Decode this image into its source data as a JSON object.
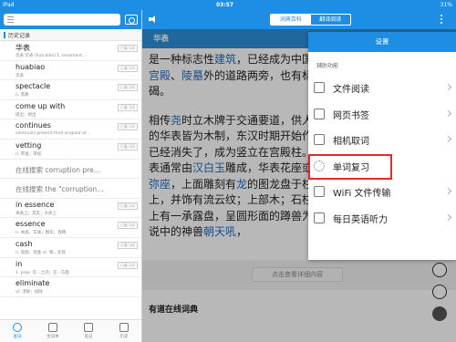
{
  "status_bar": {
    "carrier": "iPad",
    "time": "03:57",
    "battery": "31%"
  },
  "left_pane": {
    "history_header": "历史记录",
    "history": [
      {
        "word": "华表",
        "desc": "华表 华表 [huá biǎo] 1. ornament…",
        "tag": "已复习词"
      },
      {
        "word": "huabiao",
        "desc": "华表",
        "tag": "已复习词"
      },
      {
        "word": "spectacle",
        "desc": "n. 景象",
        "tag": "已复习词"
      },
      {
        "word": "come up with",
        "desc": "提出；想出",
        "tag": "已复习词"
      },
      {
        "word": "continues",
        "desc": "continues present third singular of…",
        "tag": "已复习词"
      },
      {
        "word": "vetting",
        "desc": "n. 审查；审核",
        "tag": "已复习词"
      },
      {
        "word": "在线搜索 corruption pre…",
        "desc": "",
        "tag": ""
      },
      {
        "word": "在线搜索 the \"corruption…",
        "desc": "",
        "tag": ""
      },
      {
        "word": "in essence",
        "desc": "本质上；其实；大体上",
        "tag": "已复习词"
      },
      {
        "word": "essence",
        "desc": "n. 本质，实质；精华；香精",
        "tag": "已复习词"
      },
      {
        "word": "cash",
        "desc": "n. 现款，现金 vt. 将...兑现",
        "tag": "已复习词"
      },
      {
        "word": "in",
        "desc": "1. prep. 在...之内；在...方面",
        "tag": "已复习词"
      },
      {
        "word": "eliminate",
        "desc": "vt. 消除；排除",
        "tag": ""
      }
    ],
    "tabs": [
      "查词",
      "生词本",
      "笔记",
      "历史"
    ]
  },
  "right_pane": {
    "segments": [
      "词典百科",
      "翻译阅读"
    ],
    "word_title": "华表",
    "para1": [
      {
        "t": "是一种标志性",
        "link": false
      },
      {
        "t": "建筑",
        "link": true
      },
      {
        "t": "，已经成为中国",
        "link": false
      },
      {
        "t": "在",
        "link": false
      },
      {
        "t": "宫殿",
        "link": true
      },
      {
        "t": "、",
        "link": false
      },
      {
        "t": "陵墓",
        "link": true
      },
      {
        "t": "外的道路两旁，也有",
        "link": false
      },
      {
        "t": "标，碣。",
        "link": false
      }
    ],
    "para2": [
      {
        "t": "相传",
        "link": false
      },
      {
        "t": "尧",
        "link": true
      },
      {
        "t": "时立木牌于交通要道，供人",
        "link": false
      },
      {
        "t": "古的华表皆为木制，东汉时期开始",
        "link": false
      },
      {
        "t": "作用已经消失了，成为竖立在宫殿",
        "link": false
      },
      {
        "t": "柱。华表通常由",
        "link": false
      },
      {
        "t": "汉白玉",
        "link": true
      },
      {
        "t": "雕成，华表",
        "link": false
      },
      {
        "t": "花座或",
        "link": false
      },
      {
        "t": "须弥座",
        "link": true
      },
      {
        "t": "，上面雕刻有",
        "link": false
      },
      {
        "t": "龙",
        "link": true
      },
      {
        "t": "的图",
        "link": false
      },
      {
        "t": "龙盘于柱上，并饰有流云纹；上部",
        "link": false
      },
      {
        "t": "木；石柱顶上有一承露盘，呈圆形",
        "link": false
      },
      {
        "t": "面的蹲兽为传说中的神兽",
        "link": false
      },
      {
        "t": "朝天吼",
        "link": true
      },
      {
        "t": "，",
        "link": false
      }
    ],
    "detail_button": "点击查看详细内容",
    "youdao_title": "有道在线词典"
  },
  "settings_popup": {
    "title": "设置",
    "section": "辅助功能",
    "items": [
      {
        "label": "文件阅读",
        "icon": "file-icon"
      },
      {
        "label": "网页书签",
        "icon": "bookmark-icon"
      },
      {
        "label": "相机取词",
        "icon": "camera-icon"
      },
      {
        "label": "单词复习",
        "icon": "review-icon",
        "highlighted": true
      },
      {
        "label": "WiFi 文件传输",
        "icon": "wifi-icon"
      },
      {
        "label": "每日英语听力",
        "icon": "headphones-icon"
      }
    ],
    "highlight_color": "#e12a2a"
  },
  "colors": {
    "accent": "#1e8ee5",
    "link": "#1e6fc0"
  }
}
